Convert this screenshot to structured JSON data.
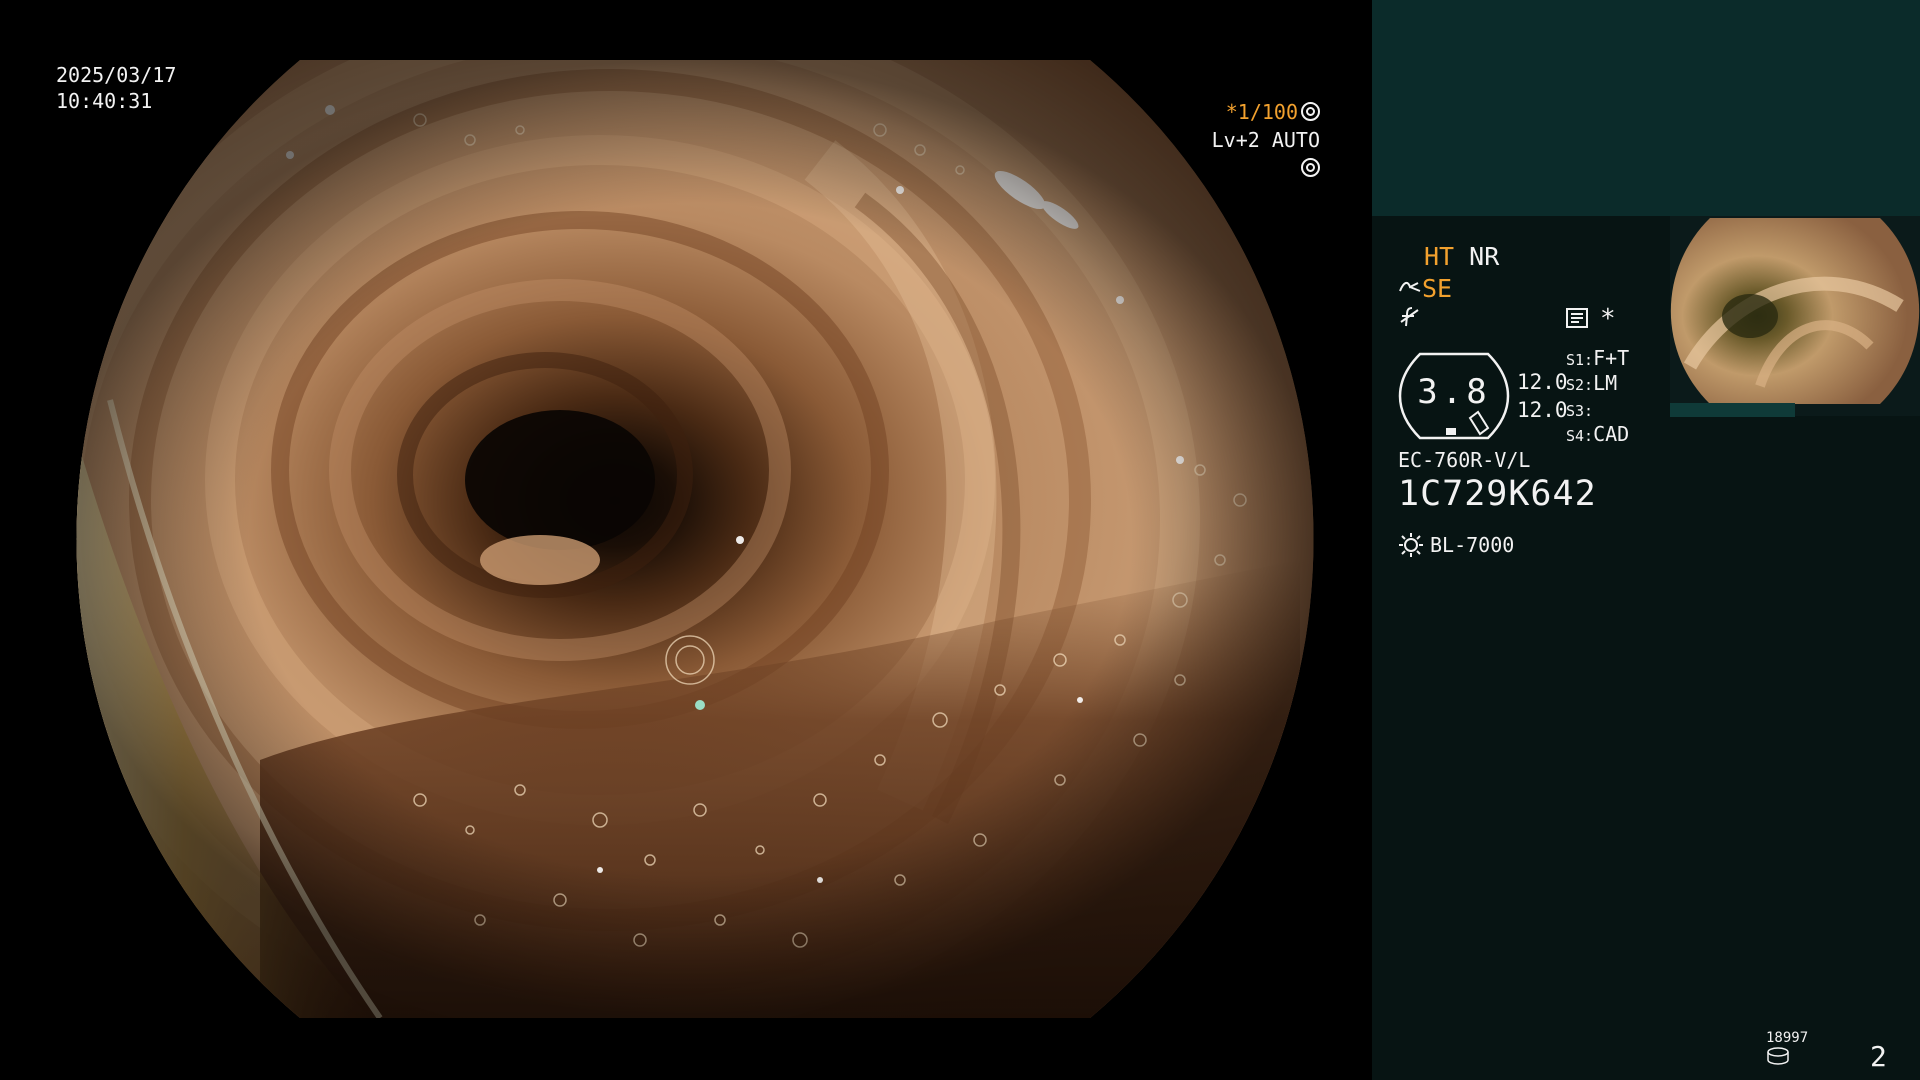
{
  "overlay": {
    "date": "2025/03/17",
    "time": "10:40:31",
    "shutter_value": "*1/100",
    "iris_mode": "Lv+2 AUTO"
  },
  "panel": {
    "mode_ht": "HT",
    "mode_nr": "NR",
    "mode_se": "SE",
    "mode_icon_1": "scissors-like-icon",
    "mode_icon_2": "strikethrough-f-icon",
    "settings_icon": "settings-doc-icon",
    "asterisk": "*",
    "zoom_value": "3.8",
    "level_a": "12.0",
    "level_b": "12.0",
    "switches": [
      {
        "key": "S1:",
        "value": "F+T"
      },
      {
        "key": "S2:",
        "value": "LM"
      },
      {
        "key": "S3:",
        "value": ""
      },
      {
        "key": "S4:",
        "value": "CAD"
      }
    ],
    "scope_model": "EC-760R-V/L",
    "scope_serial": "1C729K642",
    "light_source": "BL-7000",
    "counter": "18997",
    "page_number": "2"
  },
  "colors": {
    "orange_accent": "#f2a12e",
    "panel_bg": "#071413",
    "panel_top_bg": "#0b2b2a",
    "text": "#f2f2f2"
  }
}
